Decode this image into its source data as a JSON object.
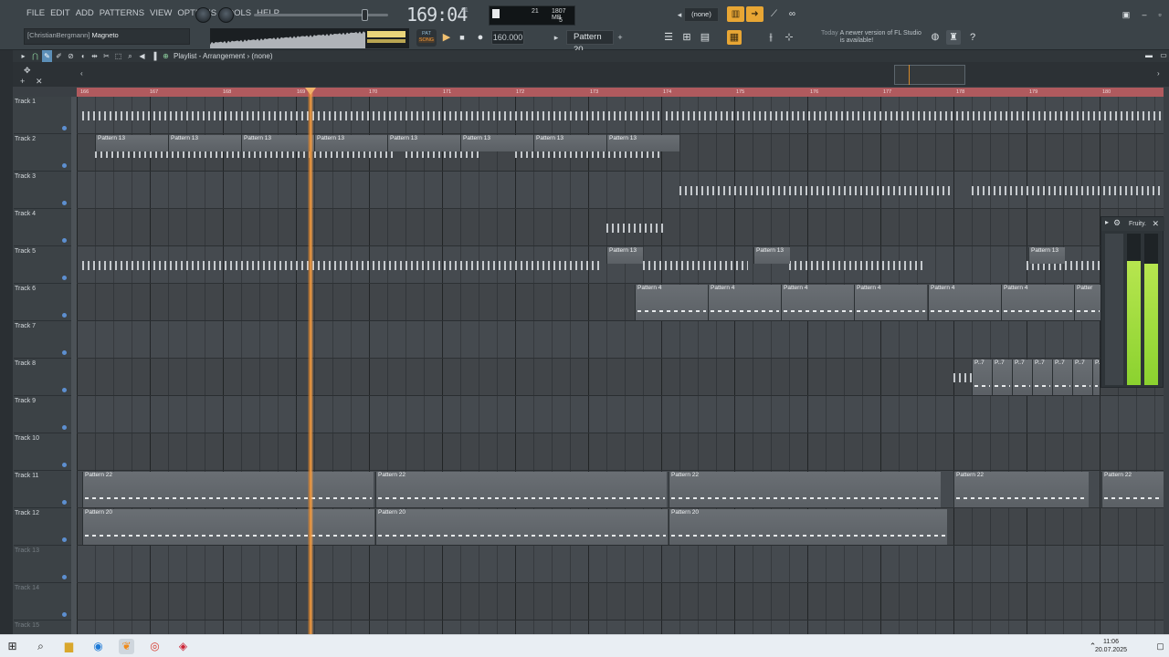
{
  "menu": [
    "FILE",
    "EDIT",
    "ADD",
    "PATTERNS",
    "VIEW",
    "OPTIONS",
    "TOOLS",
    "HELP"
  ],
  "transport": {
    "time": "169:04",
    "time_sub": "01",
    "bpm": "160.000",
    "pattern": "Pattern 20",
    "mode_pat": "PAT",
    "mode_song": "SONG",
    "play_icon": "play-icon",
    "stop_icon": "stop-icon",
    "record_icon": "record-icon"
  },
  "monitor": {
    "cpu": "21",
    "memory": "1807 MB",
    "polyphony": "5"
  },
  "hint": {
    "user": "[ChristianBergmann]",
    "text": "Magneto"
  },
  "snap": "(none)",
  "news": {
    "date": "Today",
    "text": "A newer version of FL Studio is available!"
  },
  "playlist": {
    "title": "Playlist - Arrangement",
    "separator": "›",
    "arrangement": "(none)"
  },
  "ruler": {
    "labels": [
      "166",
      "167",
      "168",
      "169",
      "170",
      "171",
      "172",
      "173",
      "174",
      "175",
      "176",
      "177",
      "178",
      "179",
      "180"
    ]
  },
  "tracks": [
    {
      "name": "Track 1",
      "active": true
    },
    {
      "name": "Track 2",
      "active": true
    },
    {
      "name": "Track 3",
      "active": true
    },
    {
      "name": "Track 4",
      "active": true
    },
    {
      "name": "Track 5",
      "active": true
    },
    {
      "name": "Track 6",
      "active": true
    },
    {
      "name": "Track 7",
      "active": true
    },
    {
      "name": "Track 8",
      "active": true
    },
    {
      "name": "Track 9",
      "active": true
    },
    {
      "name": "Track 10",
      "active": true
    },
    {
      "name": "Track 11",
      "active": true
    },
    {
      "name": "Track 12",
      "active": true
    },
    {
      "name": "Track 13",
      "active": false
    },
    {
      "name": "Track 14",
      "active": false
    },
    {
      "name": "Track 15",
      "active": false
    }
  ],
  "clips": {
    "track2": [
      "Pattern 13",
      "Pattern 13",
      "Pattern 13",
      "Pattern 13",
      "Pattern 13",
      "Pattern 13",
      "Pattern 13",
      "Pattern 13"
    ],
    "track5": [
      "Pattern 13",
      "Pattern 13",
      "Pattern 13"
    ],
    "track6": [
      "Pattern 4",
      "Pattern 4",
      "Pattern 4",
      "Pattern 4",
      "Pattern 4",
      "Pattern 4",
      "Patter"
    ],
    "track8": [
      "P..7",
      "P..7",
      "P..7",
      "P..7",
      "P..7",
      "P..7",
      "P.."
    ],
    "track11": [
      "Pattern 22",
      "Pattern 22",
      "Pattern 22",
      "Pattern 22",
      "Pattern 22"
    ],
    "track12": [
      "Pattern 20",
      "Pattern 20",
      "Pattern 20"
    ]
  },
  "plugin": {
    "title": "Fruity.",
    "levels": [
      0.82,
      0.8
    ]
  },
  "taskbar": {
    "time": "11:06",
    "date": "20.07.2025"
  },
  "colors": {
    "playhead": "#e08a32",
    "ruler": "#b05a5e",
    "meter": "#9bd83a",
    "accent": "#f0b030"
  }
}
